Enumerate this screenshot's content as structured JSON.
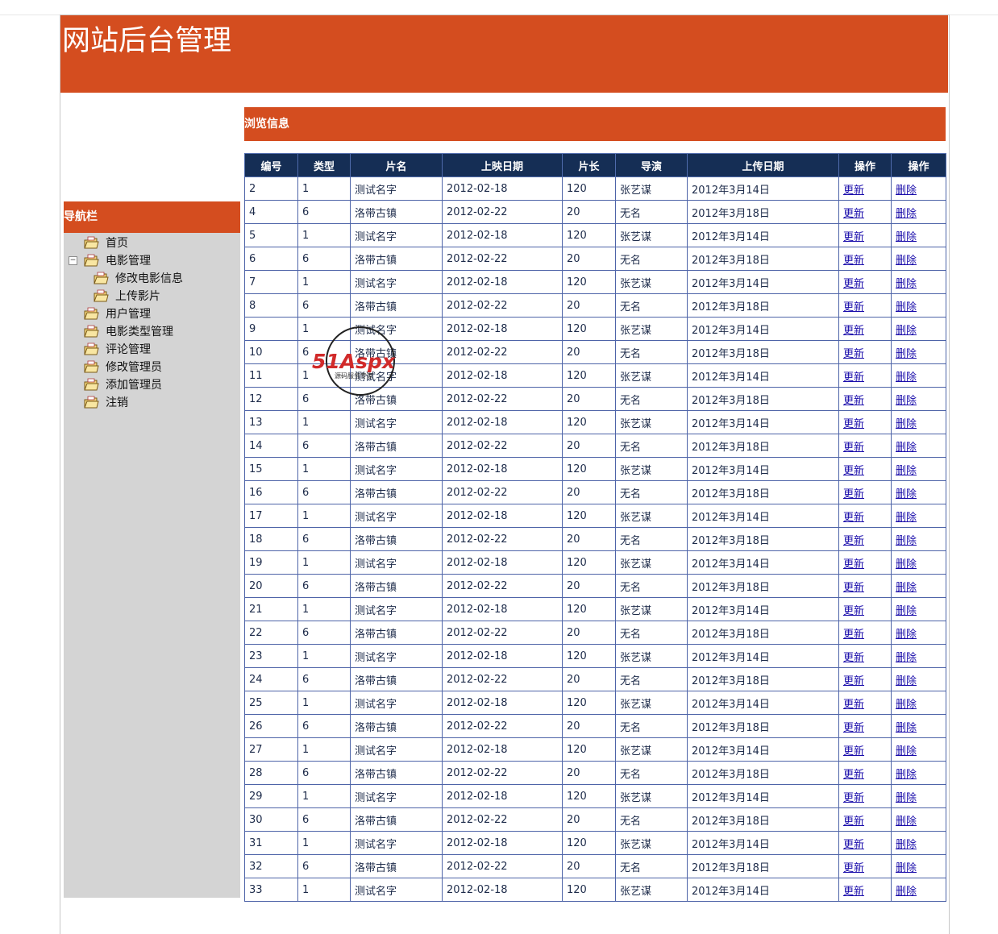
{
  "header": {
    "title": "网站后台管理"
  },
  "sidebar": {
    "title": "导航栏",
    "items": [
      {
        "label": "首页"
      },
      {
        "label": "电影管理"
      },
      {
        "label": "修改电影信息"
      },
      {
        "label": "上传影片"
      },
      {
        "label": "用户管理"
      },
      {
        "label": "电影类型管理"
      },
      {
        "label": "评论管理"
      },
      {
        "label": "修改管理员"
      },
      {
        "label": "添加管理员"
      },
      {
        "label": "注销"
      }
    ],
    "expander_symbol": "−"
  },
  "main": {
    "title": "浏览信息",
    "columns": [
      "编号",
      "类型",
      "片名",
      "上映日期",
      "片长",
      "导演",
      "上传日期",
      "操作",
      "操作"
    ],
    "update_label": "更新",
    "delete_label": "删除",
    "rows": [
      [
        "2",
        "1",
        "测试名字",
        "2012-02-18",
        "120",
        "张艺谋",
        "2012年3月14日"
      ],
      [
        "4",
        "6",
        "洛带古镇",
        "2012-02-22",
        "20",
        "无名",
        "2012年3月18日"
      ],
      [
        "5",
        "1",
        "测试名字",
        "2012-02-18",
        "120",
        "张艺谋",
        "2012年3月14日"
      ],
      [
        "6",
        "6",
        "洛带古镇",
        "2012-02-22",
        "20",
        "无名",
        "2012年3月18日"
      ],
      [
        "7",
        "1",
        "测试名字",
        "2012-02-18",
        "120",
        "张艺谋",
        "2012年3月14日"
      ],
      [
        "8",
        "6",
        "洛带古镇",
        "2012-02-22",
        "20",
        "无名",
        "2012年3月18日"
      ],
      [
        "9",
        "1",
        "测试名字",
        "2012-02-18",
        "120",
        "张艺谋",
        "2012年3月14日"
      ],
      [
        "10",
        "6",
        "洛带古镇",
        "2012-02-22",
        "20",
        "无名",
        "2012年3月18日"
      ],
      [
        "11",
        "1",
        "测试名字",
        "2012-02-18",
        "120",
        "张艺谋",
        "2012年3月14日"
      ],
      [
        "12",
        "6",
        "洛带古镇",
        "2012-02-22",
        "20",
        "无名",
        "2012年3月18日"
      ],
      [
        "13",
        "1",
        "测试名字",
        "2012-02-18",
        "120",
        "张艺谋",
        "2012年3月14日"
      ],
      [
        "14",
        "6",
        "洛带古镇",
        "2012-02-22",
        "20",
        "无名",
        "2012年3月18日"
      ],
      [
        "15",
        "1",
        "测试名字",
        "2012-02-18",
        "120",
        "张艺谋",
        "2012年3月14日"
      ],
      [
        "16",
        "6",
        "洛带古镇",
        "2012-02-22",
        "20",
        "无名",
        "2012年3月18日"
      ],
      [
        "17",
        "1",
        "测试名字",
        "2012-02-18",
        "120",
        "张艺谋",
        "2012年3月14日"
      ],
      [
        "18",
        "6",
        "洛带古镇",
        "2012-02-22",
        "20",
        "无名",
        "2012年3月18日"
      ],
      [
        "19",
        "1",
        "测试名字",
        "2012-02-18",
        "120",
        "张艺谋",
        "2012年3月14日"
      ],
      [
        "20",
        "6",
        "洛带古镇",
        "2012-02-22",
        "20",
        "无名",
        "2012年3月18日"
      ],
      [
        "21",
        "1",
        "测试名字",
        "2012-02-18",
        "120",
        "张艺谋",
        "2012年3月14日"
      ],
      [
        "22",
        "6",
        "洛带古镇",
        "2012-02-22",
        "20",
        "无名",
        "2012年3月18日"
      ],
      [
        "23",
        "1",
        "测试名字",
        "2012-02-18",
        "120",
        "张艺谋",
        "2012年3月14日"
      ],
      [
        "24",
        "6",
        "洛带古镇",
        "2012-02-22",
        "20",
        "无名",
        "2012年3月18日"
      ],
      [
        "25",
        "1",
        "测试名字",
        "2012-02-18",
        "120",
        "张艺谋",
        "2012年3月14日"
      ],
      [
        "26",
        "6",
        "洛带古镇",
        "2012-02-22",
        "20",
        "无名",
        "2012年3月18日"
      ],
      [
        "27",
        "1",
        "测试名字",
        "2012-02-18",
        "120",
        "张艺谋",
        "2012年3月14日"
      ],
      [
        "28",
        "6",
        "洛带古镇",
        "2012-02-22",
        "20",
        "无名",
        "2012年3月18日"
      ],
      [
        "29",
        "1",
        "测试名字",
        "2012-02-18",
        "120",
        "张艺谋",
        "2012年3月14日"
      ],
      [
        "30",
        "6",
        "洛带古镇",
        "2012-02-22",
        "20",
        "无名",
        "2012年3月18日"
      ],
      [
        "31",
        "1",
        "测试名字",
        "2012-02-18",
        "120",
        "张艺谋",
        "2012年3月14日"
      ],
      [
        "32",
        "6",
        "洛带古镇",
        "2012-02-22",
        "20",
        "无名",
        "2012年3月18日"
      ],
      [
        "33",
        "1",
        "测试名字",
        "2012-02-18",
        "120",
        "张艺谋",
        "2012年3月14日"
      ]
    ]
  },
  "watermark": {
    "brand": "51Aspx",
    "tagline": "源码服务专家"
  },
  "colors": {
    "accent": "#d44d1f",
    "table_header": "#152e55",
    "table_border": "#4e64a8",
    "sidebar_bg": "#d4d4d4",
    "link": "#1a0dab"
  },
  "icons": {
    "tree_item": "folder-icon",
    "expander": "collapse-icon"
  }
}
